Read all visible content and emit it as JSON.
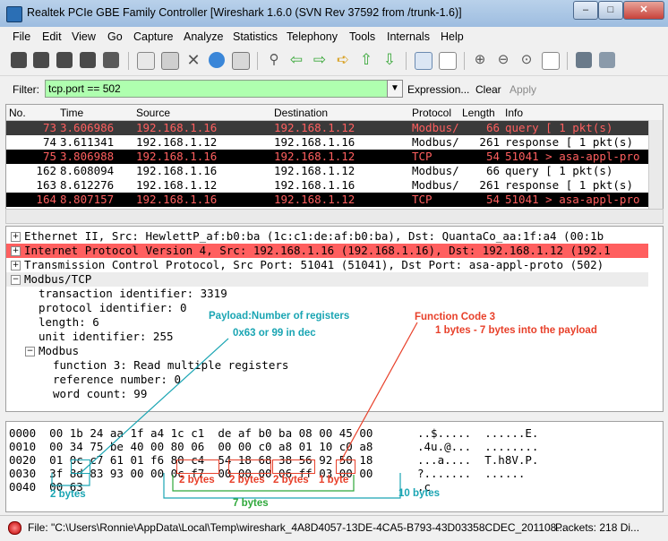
{
  "window": {
    "title": "Realtek PCIe GBE Family Controller  [Wireshark 1.6.0  (SVN Rev 37592 from /trunk-1.6)]",
    "min": "–",
    "max": "□",
    "close": "✕"
  },
  "menu": [
    "File",
    "Edit",
    "View",
    "Go",
    "Capture",
    "Analyze",
    "Statistics",
    "Telephony",
    "Tools",
    "Internals",
    "Help"
  ],
  "toolbar_icons": [
    "interfaces-icon",
    "options-icon",
    "start-icon",
    "stop-icon",
    "restart-icon",
    "open-icon",
    "save-icon",
    "close-file-icon",
    "reload-icon",
    "print-icon",
    "find-icon",
    "back-icon",
    "forward-icon",
    "goto-icon",
    "first-icon",
    "last-icon",
    "colorize-icon",
    "autoscroll-icon",
    "zoom-in-icon",
    "zoom-out-icon",
    "normal-size-icon",
    "resize-columns-icon",
    "capture-filters-icon",
    "display-filters-icon"
  ],
  "filter": {
    "label": "Filter:",
    "value": "tcp.port == 502",
    "expression": "Expression...",
    "clear": "Clear",
    "apply": "Apply"
  },
  "columns": [
    "No.",
    "Time",
    "Source",
    "Destination",
    "Protocol",
    "Length",
    "Info"
  ],
  "packets": [
    {
      "no": "73",
      "time": "3.606986",
      "src": "192.168.1.16",
      "dst": "192.168.1.12",
      "proto": "Modbus/",
      "len": "66",
      "info": "  query [ 1 pkt(s)",
      "style": "sel"
    },
    {
      "no": "74",
      "time": "3.611341",
      "src": "192.168.1.12",
      "dst": "192.168.1.16",
      "proto": "Modbus/",
      "len": "261",
      "info": "response [ 1 pkt(s)",
      "style": "normal"
    },
    {
      "no": "75",
      "time": "3.806988",
      "src": "192.168.1.16",
      "dst": "192.168.1.12",
      "proto": "TCP",
      "len": "54",
      "info": "51041 > asa-appl-pro",
      "style": "tcp"
    },
    {
      "no": "162",
      "time": "8.608094",
      "src": "192.168.1.16",
      "dst": "192.168.1.12",
      "proto": "Modbus/",
      "len": "66",
      "info": "  query [ 1 pkt(s)",
      "style": "normal"
    },
    {
      "no": "163",
      "time": "8.612276",
      "src": "192.168.1.12",
      "dst": "192.168.1.16",
      "proto": "Modbus/",
      "len": "261",
      "info": "response [ 1 pkt(s)",
      "style": "normal"
    },
    {
      "no": "164",
      "time": "8.807157",
      "src": "192.168.1.16",
      "dst": "192.168.1.12",
      "proto": "TCP",
      "len": "54",
      "info": "51041 > asa-appl-pro",
      "style": "tcp"
    }
  ],
  "details": [
    {
      "ex": "+",
      "indent": 0,
      "text": "Ethernet II, Src: HewlettP_af:b0:ba (1c:c1:de:af:b0:ba), Dst: QuantaCo_aa:1f:a4 (00:1b",
      "style": ""
    },
    {
      "ex": "+",
      "indent": 0,
      "text": "Internet Protocol Version 4, Src: 192.168.1.16 (192.168.1.16), Dst: 192.168.1.12 (192.1",
      "style": "hl"
    },
    {
      "ex": "+",
      "indent": 0,
      "text": "Transmission Control Protocol, Src Port: 51041 (51041), Dst Port: asa-appl-proto (502)",
      "style": ""
    },
    {
      "ex": "−",
      "indent": 0,
      "text": "Modbus/TCP",
      "style": "sel"
    },
    {
      "ex": "",
      "indent": 1,
      "text": "transaction identifier: 3319",
      "style": ""
    },
    {
      "ex": "",
      "indent": 1,
      "text": "protocol identifier: 0",
      "style": ""
    },
    {
      "ex": "",
      "indent": 1,
      "text": "length: 6",
      "style": ""
    },
    {
      "ex": "",
      "indent": 1,
      "text": "unit identifier: 255",
      "style": ""
    },
    {
      "ex": "−",
      "indent": 1,
      "text": "Modbus",
      "style": ""
    },
    {
      "ex": "",
      "indent": 2,
      "text": "function 3:  Read multiple registers",
      "style": ""
    },
    {
      "ex": "",
      "indent": 2,
      "text": "reference number: 0",
      "style": ""
    },
    {
      "ex": "",
      "indent": 2,
      "text": "word count: 99",
      "style": ""
    }
  ],
  "hex": [
    {
      "off": "0000",
      "bytes": "00 1b 24 aa 1f a4 1c c1  de af b0 ba 08 00 45 00",
      "ascii": "..$.....  ......E."
    },
    {
      "off": "0010",
      "bytes": "00 34 75 be 40 00 80 06  00 00 c0 a8 01 10 c0 a8",
      "ascii": ".4u.@...  ........"
    },
    {
      "off": "0020",
      "bytes": "01 0c c7 61 01 f6 80 c4  54 18 68 38 56 92 50 18",
      "ascii": "...a....  T.h8V.P."
    },
    {
      "off": "0030",
      "bytes": "3f 8d 83 93 00 00 0c f7  00 00 00 06 ff 03 00 00",
      "ascii": "?.......  ......"
    },
    {
      "off": "0040",
      "bytes": "00 63",
      "ascii": ".c"
    }
  ],
  "annotations": {
    "payload_title": "Payload:Number of registers",
    "payload_value": "0x63 or 99 in dec",
    "fc_title": "Function Code 3",
    "fc_detail": "1 bytes - 7 bytes into the payload",
    "two_bytes": "2 bytes",
    "one_byte": "1 byte",
    "seven_bytes": "7 bytes",
    "ten_bytes": "10 bytes",
    "colors": {
      "teal": "#1aa5b3",
      "red": "#e8402a",
      "green": "#2ea83a"
    }
  },
  "status": {
    "file": "File: \"C:\\Users\\Ronnie\\AppData\\Local\\Temp\\wireshark_4A8D4057-13DE-4CA5-B793-43D03358CDEC_201108...",
    "packets": "Packets: 218 Di..."
  }
}
